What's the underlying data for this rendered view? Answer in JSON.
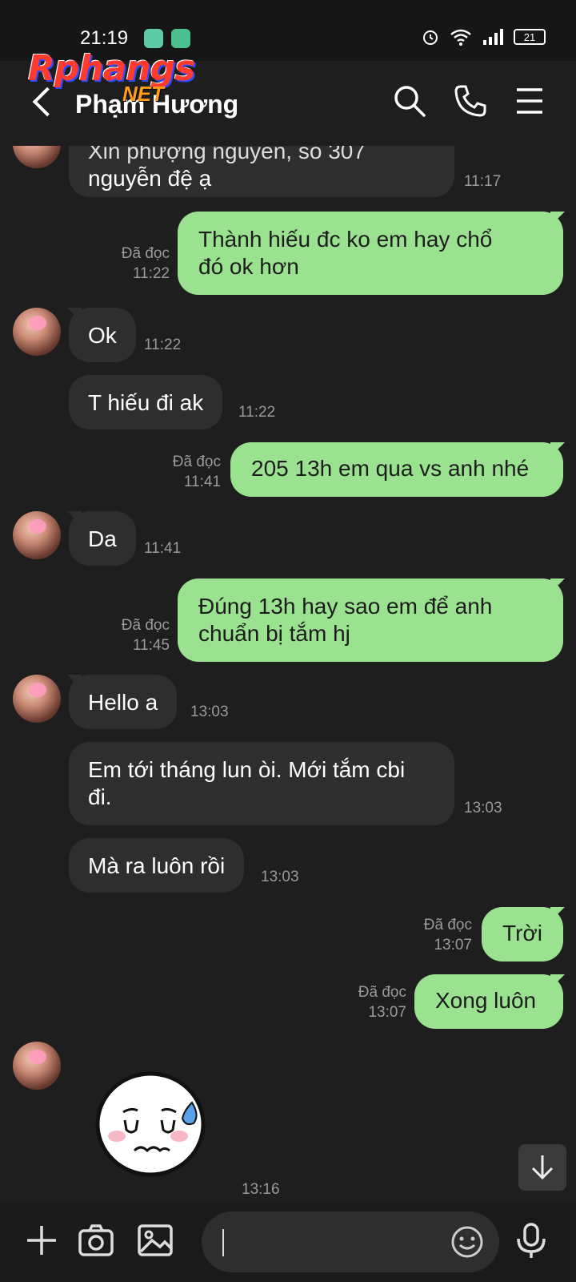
{
  "status": {
    "time": "21:19",
    "battery": "21"
  },
  "watermark": {
    "main": "Rphangs",
    "net": "NET"
  },
  "header": {
    "contact_name": "Phạm Hương"
  },
  "messages": [
    {
      "dir": "in",
      "text_line1": "Xin phượng nguyễn, số 307",
      "text_line2": "nguyễn đệ ạ",
      "time": "11:17"
    },
    {
      "dir": "out",
      "text_line1": "Thành hiếu đc ko em hay chổ",
      "text_line2": "đó ok hơn",
      "read": "Đã đọc",
      "time": "11:22"
    },
    {
      "dir": "in",
      "text": "Ok",
      "time": "11:22"
    },
    {
      "dir": "in",
      "text": "T hiếu đi ak",
      "time": "11:22"
    },
    {
      "dir": "out",
      "text": "205 13h em qua vs anh nhé",
      "read": "Đã đọc",
      "time": "11:41"
    },
    {
      "dir": "in",
      "text": "Da",
      "time": "11:41"
    },
    {
      "dir": "out",
      "text_line1": "Đúng 13h hay sao em để anh",
      "text_line2": "chuẩn bị tắm hj",
      "read": "Đã đọc",
      "time": "11:45"
    },
    {
      "dir": "in",
      "text": "Hello a",
      "time": "13:03"
    },
    {
      "dir": "in",
      "text_line1": "Em tới tháng lun òi. Mới tắm cbi",
      "text_line2": "đi.",
      "time": "13:03"
    },
    {
      "dir": "in",
      "text": "Mà ra luôn rồi",
      "time": "13:03"
    },
    {
      "dir": "out",
      "text": "Trời",
      "read": "Đã đọc",
      "time": "13:07"
    },
    {
      "dir": "out",
      "text": "Xong luôn",
      "read": "Đã đọc",
      "time": "13:07"
    },
    {
      "dir": "in",
      "sticker": "sweat-face-sticker",
      "time": "13:16"
    }
  ],
  "colors": {
    "incoming": "#2e2e2e",
    "outgoing": "#9ae28f",
    "background": "#1e1e1e"
  },
  "icons": [
    "back-icon",
    "search-icon",
    "call-icon",
    "menu-icon",
    "plus-icon",
    "camera-icon",
    "image-icon",
    "emoji-icon",
    "mic-icon",
    "arrow-down-icon"
  ]
}
